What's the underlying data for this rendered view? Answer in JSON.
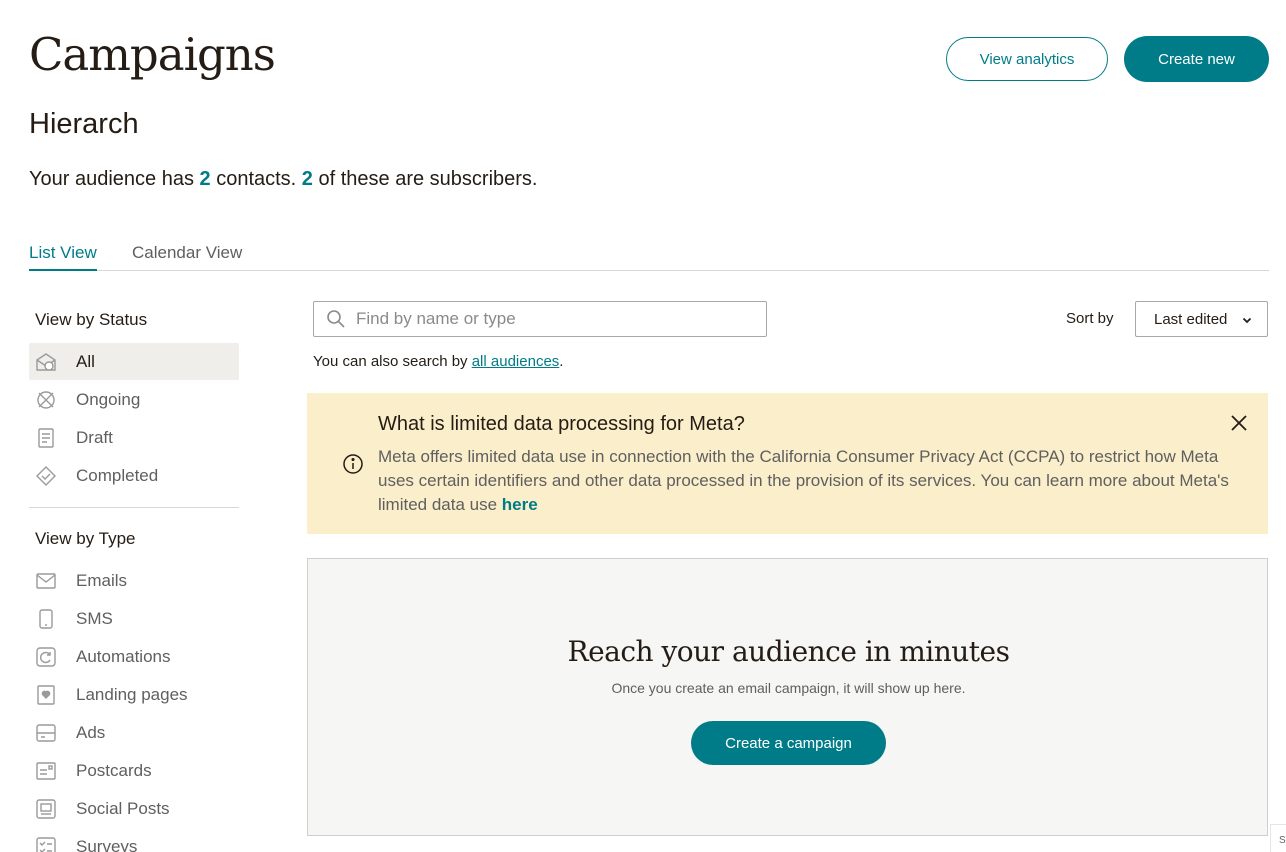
{
  "header": {
    "title": "Campaigns",
    "view_analytics_label": "View analytics",
    "create_new_label": "Create new"
  },
  "audience": {
    "name": "Hierarch",
    "summary_prefix": "Your audience has ",
    "contacts_count": "2",
    "summary_middle": " contacts. ",
    "subscribers_count": "2",
    "summary_suffix": " of these are subscribers."
  },
  "tabs": [
    {
      "label": "List View",
      "active": true
    },
    {
      "label": "Calendar View",
      "active": false
    }
  ],
  "sidebar": {
    "status_heading": "View by Status",
    "status_items": [
      {
        "label": "All",
        "icon": "all-campaigns-icon",
        "active": true
      },
      {
        "label": "Ongoing",
        "icon": "ongoing-icon"
      },
      {
        "label": "Draft",
        "icon": "draft-icon"
      },
      {
        "label": "Completed",
        "icon": "completed-icon"
      }
    ],
    "type_heading": "View by Type",
    "type_items": [
      {
        "label": "Emails",
        "icon": "email-icon"
      },
      {
        "label": "SMS",
        "icon": "phone-icon"
      },
      {
        "label": "Automations",
        "icon": "automation-icon"
      },
      {
        "label": "Landing pages",
        "icon": "landing-page-icon"
      },
      {
        "label": "Ads",
        "icon": "ads-icon"
      },
      {
        "label": "Postcards",
        "icon": "postcard-icon"
      },
      {
        "label": "Social Posts",
        "icon": "social-post-icon"
      },
      {
        "label": "Surveys",
        "icon": "survey-icon"
      }
    ]
  },
  "search": {
    "placeholder": "Find by name or type",
    "value": "",
    "hint_prefix": "You can also search by ",
    "hint_link": "all audiences",
    "hint_suffix": "."
  },
  "sort": {
    "label": "Sort by",
    "selected": "Last edited"
  },
  "banner": {
    "title": "What is limited data processing for Meta?",
    "body": "Meta offers limited data use in connection with the California Consumer Privacy Act (CCPA) to restrict how Meta uses certain identifiers and other data processed in the provision of its services. You can learn more about Meta's limited data use ",
    "link": "here"
  },
  "empty_state": {
    "title": "Reach your audience in minutes",
    "subtitle": "Once you create an email campaign, it will show up here.",
    "button_label": "Create a campaign"
  },
  "edge_tab": {
    "label": "S"
  },
  "colors": {
    "accent": "#007c89",
    "text": "#241c15",
    "muted": "#5f5f5f",
    "banner_bg": "#fbeecb",
    "empty_bg": "#f6f6f4",
    "active_item_bg": "#efeeea"
  }
}
